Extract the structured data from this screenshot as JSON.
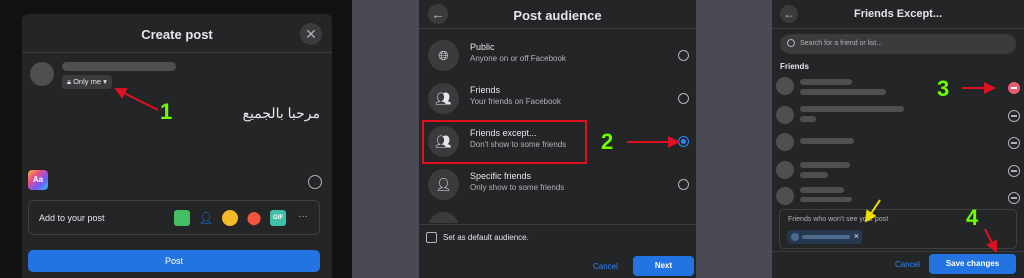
{
  "create_post": {
    "title": "Create post",
    "privacy_label": "Only me",
    "message_text": "مرحبا بالجميع",
    "bg_button_text": "Aa",
    "add_to_post_label": "Add to your post",
    "post_button": "Post",
    "tools": [
      "photo-icon",
      "tag-people-icon",
      "feeling-icon",
      "check-in-icon",
      "gif-icon",
      "more-icon"
    ],
    "colors": {
      "photo": "#45bd62",
      "tag": "#1877f2",
      "feeling": "#f7b928",
      "checkin": "#f5533d",
      "gif": "#3fbfa8"
    }
  },
  "post_audience": {
    "title": "Post audience",
    "options": [
      {
        "title": "Public",
        "desc": "Anyone on or off Facebook",
        "icon": "globe-icon",
        "selected": false
      },
      {
        "title": "Friends",
        "desc": "Your friends on Facebook",
        "icon": "friends-icon",
        "selected": false
      },
      {
        "title": "Friends except...",
        "desc": "Don't show to some friends",
        "icon": "friends-except-icon",
        "selected": true
      },
      {
        "title": "Specific friends",
        "desc": "Only show to some friends",
        "icon": "specific-friends-icon",
        "selected": false
      }
    ],
    "default_checkbox_label": "Set as default audience.",
    "cancel_label": "Cancel",
    "next_label": "Next"
  },
  "friends_except": {
    "title": "Friends Except...",
    "search_placeholder": "Search for a friend or list...",
    "section_label": "Friends",
    "except_box_label": "Friends who won't see your post",
    "cancel_label": "Cancel",
    "save_label": "Save changes"
  },
  "annotations": {
    "step1": "1",
    "step2": "2",
    "step3": "3",
    "step4": "4",
    "colors": {
      "step": "#6bff00",
      "arrow": "#e01020",
      "highlight": "#e01020",
      "yellow_arrow": "#f0e000"
    }
  }
}
